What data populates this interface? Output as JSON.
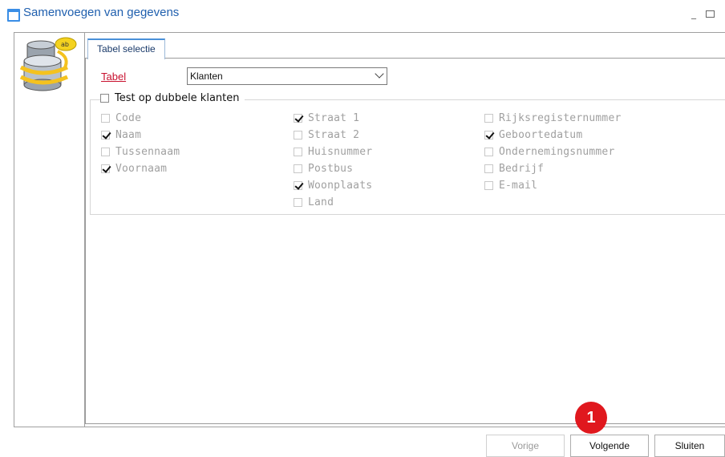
{
  "window": {
    "title": "Samenvoegen van gegevens",
    "minimize_glyph": "_"
  },
  "tabs": [
    {
      "label": "Tabel selectie",
      "active": true
    }
  ],
  "form": {
    "tabel_label": "Tabel",
    "tabel_value": "Klanten"
  },
  "group": {
    "label": "Test op dubbele klanten",
    "checked": false,
    "columns": [
      [
        {
          "label": "Code",
          "checked": false
        },
        {
          "label": "Naam",
          "checked": true
        },
        {
          "label": "Tussennaam",
          "checked": false
        },
        {
          "label": "Voornaam",
          "checked": true
        }
      ],
      [
        {
          "label": "Straat 1",
          "checked": true
        },
        {
          "label": "Straat 2",
          "checked": false
        },
        {
          "label": "Huisnummer",
          "checked": false
        },
        {
          "label": "Postbus",
          "checked": false
        },
        {
          "label": "Woonplaats",
          "checked": true
        },
        {
          "label": "Land",
          "checked": false
        }
      ],
      [
        {
          "label": "Rijksregisternummer",
          "checked": false
        },
        {
          "label": "Geboortedatum",
          "checked": true
        },
        {
          "label": "Ondernemingsnummer",
          "checked": false
        },
        {
          "label": "Bedrijf",
          "checked": false
        },
        {
          "label": "E-mail",
          "checked": false
        }
      ]
    ]
  },
  "buttons": {
    "vorige": "Vorige",
    "volgende": "Volgende",
    "sluiten": "Sluiten"
  },
  "annotation": {
    "step": "1",
    "color": "#e0181e"
  },
  "colors": {
    "title": "#1f5fae",
    "label_red": "#c8102e"
  }
}
